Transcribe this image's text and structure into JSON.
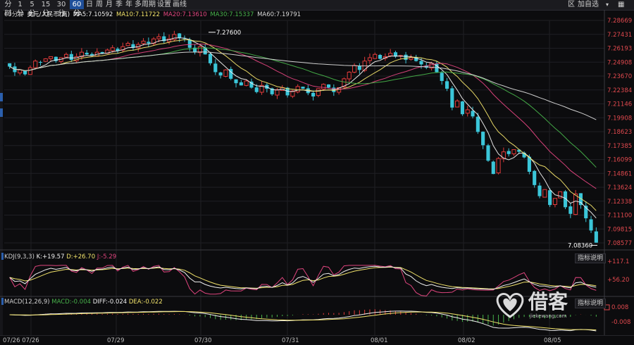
{
  "toolbar": {
    "tabs": [
      {
        "label": "分时",
        "active": false
      },
      {
        "label": "1分",
        "active": false
      },
      {
        "label": "5分",
        "active": false
      },
      {
        "label": "15分",
        "active": false
      },
      {
        "label": "30分",
        "active": false
      },
      {
        "label": "60分",
        "active": true
      },
      {
        "label": "日",
        "active": false
      },
      {
        "label": "周",
        "active": false
      },
      {
        "label": "月",
        "active": false
      },
      {
        "label": "季",
        "active": false
      },
      {
        "label": "年",
        "active": false
      },
      {
        "label": "多周期",
        "active": false
      },
      {
        "label": "设置",
        "active": false
      },
      {
        "label": "画线",
        "active": false
      }
    ],
    "right_region": "区",
    "right_add": "加自选"
  },
  "ma_header": {
    "period": "60分钟",
    "instrument": "美元/人民币(离)",
    "ma5_label": "MA5:",
    "ma5": "7.10592",
    "ma10_label": "MA10:",
    "ma10": "7.11722",
    "ma20_label": "MA20:",
    "ma20": "7.13610",
    "ma30_label": "MA30:",
    "ma30": "7.15337",
    "ma60_label": "MA60:",
    "ma60": "7.19791"
  },
  "colors": {
    "up": "#e23b3b",
    "down": "#3bc6d9",
    "ma5": "#f0f0f0",
    "ma10": "#f2e36b",
    "ma20": "#e0457e",
    "ma30": "#47b14a",
    "ma60": "#d9d9d9",
    "axis_text": "#e0494e"
  },
  "price_axis": {
    "ticks": [
      "7.28669",
      "7.27431",
      "7.26193",
      "7.24908",
      "7.23670",
      "7.22384",
      "7.21146",
      "7.19908",
      "7.18623",
      "7.17385",
      "7.16099",
      "7.14861",
      "7.13624",
      "7.12338",
      "7.11100",
      "7.09815",
      "7.08577"
    ]
  },
  "annotations": {
    "high": "7.27600",
    "low": "7.08360"
  },
  "kdj": {
    "title": "KDJ(9,3,3)",
    "k_label": "K:",
    "k": "+19.57",
    "d_label": "D:",
    "d": "+26.70",
    "j_label": "J:",
    "j": "-5.29",
    "ticks": [
      "+117.1",
      "+56.20"
    ],
    "button": "指标说明"
  },
  "macd": {
    "title": "MACD(12,26,9)",
    "macd_label": "MACD:",
    "macd": "-0.004",
    "diff_label": "DIFF:",
    "diff": "-0.024",
    "dea_label": "DEA:",
    "dea": "-0.022",
    "ticks": [
      "0.008",
      "-0.008"
    ],
    "button": "指标说明"
  },
  "x_axis": [
    "07/26 07/26",
    "07/29",
    "07/30",
    "07/31",
    "08/01",
    "08/02",
    "08/05"
  ],
  "watermark": {
    "text": "借客",
    "url": "jiekewang.com"
  },
  "chart_data": {
    "type": "candlestick",
    "period": "60分钟",
    "instrument": "美元/人民币(离)",
    "ylim": [
      7.08577,
      7.28669
    ],
    "x_ticks": [
      "07/26",
      "07/29",
      "07/30",
      "07/31",
      "08/01",
      "08/02",
      "08/05"
    ],
    "close": [
      7.245,
      7.24,
      7.242,
      7.238,
      7.244,
      7.25,
      7.249,
      7.252,
      7.254,
      7.25,
      7.253,
      7.256,
      7.251,
      7.254,
      7.258,
      7.256,
      7.255,
      7.258,
      7.257,
      7.26,
      7.262,
      7.259,
      7.263,
      7.266,
      7.262,
      7.265,
      7.268,
      7.266,
      7.27,
      7.272,
      7.268,
      7.27,
      7.274,
      7.271,
      7.27,
      7.262,
      7.258,
      7.263,
      7.256,
      7.248,
      7.24,
      7.237,
      7.242,
      7.234,
      7.23,
      7.228,
      7.232,
      7.226,
      7.222,
      7.228,
      7.225,
      7.22,
      7.224,
      7.226,
      7.219,
      7.223,
      7.227,
      7.225,
      7.221,
      7.218,
      7.225,
      7.229,
      7.226,
      7.222,
      7.226,
      7.234,
      7.24,
      7.246,
      7.242,
      7.25,
      7.253,
      7.256,
      7.252,
      7.254,
      7.257,
      7.254,
      7.255,
      7.251,
      7.253,
      7.25,
      7.247,
      7.244,
      7.248,
      7.24,
      7.232,
      7.225,
      7.208,
      7.214,
      7.202,
      7.206,
      7.2,
      7.186,
      7.174,
      7.16,
      7.148,
      7.162,
      7.168,
      7.166,
      7.17,
      7.168,
      7.163,
      7.15,
      7.138,
      7.128,
      7.134,
      7.12,
      7.126,
      7.132,
      7.118,
      7.112,
      7.13,
      7.12,
      7.108,
      7.097,
      7.086
    ],
    "high_label": 7.276,
    "low_label": 7.0836,
    "ma_latest": {
      "MA5": 7.10592,
      "MA10": 7.11722,
      "MA20": 7.1361,
      "MA30": 7.15337,
      "MA60": 7.19791
    },
    "kdj_latest": {
      "K": 19.57,
      "D": 26.7,
      "J": -5.29
    },
    "macd_latest": {
      "MACD": -0.004,
      "DIFF": -0.024,
      "DEA": -0.022
    }
  }
}
